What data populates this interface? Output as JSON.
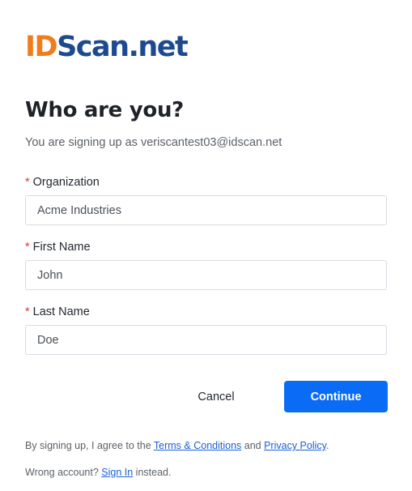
{
  "logo": {
    "id_part": "ID",
    "rest_part": "Scan.net"
  },
  "header": {
    "title": "Who are you?",
    "subtitle_prefix": "You are signing up as ",
    "email": "veriscantest03@idscan.net"
  },
  "form": {
    "required_mark": "*",
    "organization": {
      "label": "Organization",
      "value": "Acme Industries"
    },
    "first_name": {
      "label": "First Name",
      "value": "John"
    },
    "last_name": {
      "label": "Last Name",
      "value": "Doe"
    }
  },
  "actions": {
    "cancel_label": "Cancel",
    "continue_label": "Continue"
  },
  "footer": {
    "agree_prefix": "By signing up, I agree to the ",
    "terms_link": "Terms & Conditions",
    "agree_middle": " and ",
    "privacy_link": "Privacy Policy",
    "agree_suffix": ".",
    "wrong_prefix": "Wrong account? ",
    "sign_in_link": "Sign In",
    "wrong_suffix": " instead."
  },
  "colors": {
    "accent": "#0a6cf5",
    "logo_orange": "#f07c1b",
    "logo_blue": "#1d4a8f",
    "required": "#d93b3b"
  }
}
